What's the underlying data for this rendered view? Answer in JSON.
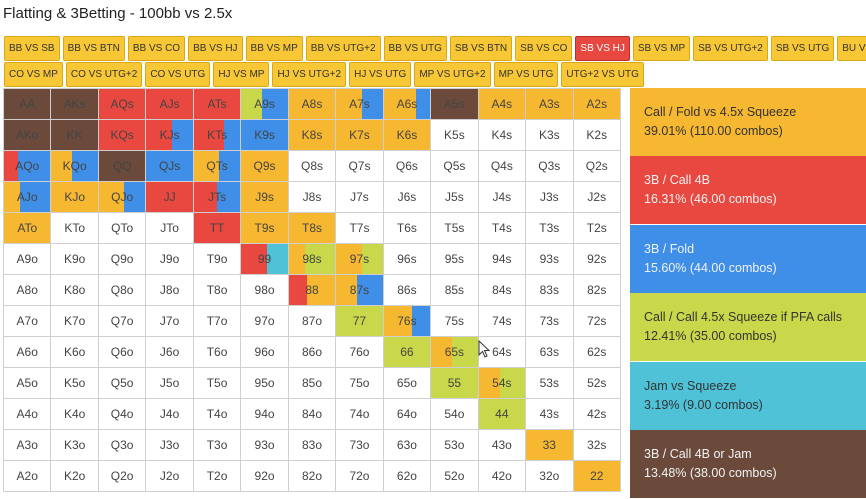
{
  "title": "Flatting & 3Betting - 100bb vs 2.5x",
  "colors": {
    "call": "#f6b731",
    "threebet_call": "#e84840",
    "threebet_fold": "#3f8fe8",
    "call_squeeze": "#c8d84a",
    "jam": "#4fc2d7",
    "threebet_jam": "#6b4a3c"
  },
  "tabs_row1": [
    "BB VS SB",
    "BB VS BTN",
    "BB VS CO",
    "BB VS HJ",
    "BB VS MP",
    "BB VS UTG+2",
    "BB VS UTG",
    "SB VS BTN",
    "SB VS CO",
    "SB VS HJ",
    "SB VS MP",
    "SB VS UTG+2",
    "SB VS UTG",
    "BU VS I"
  ],
  "tabs_row2": [
    "CO VS MP",
    "CO VS UTG+2",
    "CO VS UTG",
    "HJ VS MP",
    "HJ VS UTG+2",
    "HJ VS UTG",
    "MP VS UTG+2",
    "MP VS UTG",
    "UTG+2 VS UTG"
  ],
  "active_tab": "SB VS HJ",
  "legend": [
    {
      "key": "call",
      "name": "Call / Fold vs 4.5x Squeeze",
      "stat": "39.01% (110.00 combos)"
    },
    {
      "key": "threebet_call",
      "name": "3B / Call 4B",
      "stat": "16.31% (46.00 combos)"
    },
    {
      "key": "threebet_fold",
      "name": "3B / Fold",
      "stat": "15.60% (44.00 combos)"
    },
    {
      "key": "call_squeeze",
      "name": "Call / Call 4.5x Squeeze if PFA calls",
      "stat": "12.41% (35.00 combos)"
    },
    {
      "key": "jam",
      "name": "Jam vs Squeeze",
      "stat": "3.19% (9.00 combos)"
    },
    {
      "key": "threebet_jam",
      "name": "3B / Call 4B or Jam",
      "stat": "13.48% (38.00 combos)"
    }
  ],
  "hands": [
    [
      "AA",
      "AKs",
      "AQs",
      "AJs",
      "ATs",
      "A9s",
      "A8s",
      "A7s",
      "A6s",
      "A5s",
      "A4s",
      "A3s",
      "A2s"
    ],
    [
      "AKo",
      "KK",
      "KQs",
      "KJs",
      "KTs",
      "K9s",
      "K8s",
      "K7s",
      "K6s",
      "K5s",
      "K4s",
      "K3s",
      "K2s"
    ],
    [
      "AQo",
      "KQo",
      "QQ",
      "QJs",
      "QTs",
      "Q9s",
      "Q8s",
      "Q7s",
      "Q6s",
      "Q5s",
      "Q4s",
      "Q3s",
      "Q2s"
    ],
    [
      "AJo",
      "KJo",
      "QJo",
      "JJ",
      "JTs",
      "J9s",
      "J8s",
      "J7s",
      "J6s",
      "J5s",
      "J4s",
      "J3s",
      "J2s"
    ],
    [
      "ATo",
      "KTo",
      "QTo",
      "JTo",
      "TT",
      "T9s",
      "T8s",
      "T7s",
      "T6s",
      "T5s",
      "T4s",
      "T3s",
      "T2s"
    ],
    [
      "A9o",
      "K9o",
      "Q9o",
      "J9o",
      "T9o",
      "99",
      "98s",
      "97s",
      "96s",
      "95s",
      "94s",
      "93s",
      "92s"
    ],
    [
      "A8o",
      "K8o",
      "Q8o",
      "J8o",
      "T8o",
      "98o",
      "88",
      "87s",
      "86s",
      "85s",
      "84s",
      "83s",
      "82s"
    ],
    [
      "A7o",
      "K7o",
      "Q7o",
      "J7o",
      "T7o",
      "97o",
      "87o",
      "77",
      "76s",
      "75s",
      "74s",
      "73s",
      "72s"
    ],
    [
      "A6o",
      "K6o",
      "Q6o",
      "J6o",
      "T6o",
      "96o",
      "86o",
      "76o",
      "66",
      "65s",
      "64s",
      "63s",
      "62s"
    ],
    [
      "A5o",
      "K5o",
      "Q5o",
      "J5o",
      "T5o",
      "95o",
      "85o",
      "75o",
      "65o",
      "55",
      "54s",
      "53s",
      "52s"
    ],
    [
      "A4o",
      "K4o",
      "Q4o",
      "J4o",
      "T4o",
      "94o",
      "84o",
      "74o",
      "64o",
      "54o",
      "44",
      "43s",
      "42s"
    ],
    [
      "A3o",
      "K3o",
      "Q3o",
      "J3o",
      "T3o",
      "93o",
      "83o",
      "73o",
      "63o",
      "53o",
      "43o",
      "33",
      "32s"
    ],
    [
      "A2o",
      "K2o",
      "Q2o",
      "J2o",
      "T2o",
      "92o",
      "82o",
      "72o",
      "62o",
      "52o",
      "42o",
      "32o",
      "22"
    ]
  ],
  "strategy": {
    "AA": [
      [
        "threebet_jam",
        1.0
      ]
    ],
    "AKs": [
      [
        "threebet_jam",
        1.0
      ]
    ],
    "AQs": [
      [
        "threebet_call",
        1.0
      ]
    ],
    "AJs": [
      [
        "threebet_call",
        1.0
      ]
    ],
    "ATs": [
      [
        "threebet_call",
        1.0
      ]
    ],
    "A9s": [
      [
        "call_squeeze",
        0.45
      ],
      [
        "threebet_fold",
        0.55
      ]
    ],
    "A8s": [
      [
        "call",
        1.0
      ]
    ],
    "A7s": [
      [
        "call",
        0.55
      ],
      [
        "threebet_fold",
        0.45
      ]
    ],
    "A6s": [
      [
        "call",
        0.7
      ],
      [
        "threebet_fold",
        0.3
      ]
    ],
    "A5s": [
      [
        "threebet_jam",
        1.0
      ]
    ],
    "A4s": [
      [
        "call",
        1.0
      ]
    ],
    "A3s": [
      [
        "call",
        1.0
      ]
    ],
    "A2s": [
      [
        "call",
        1.0
      ]
    ],
    "AKo": [
      [
        "threebet_jam",
        1.0
      ]
    ],
    "KK": [
      [
        "threebet_jam",
        1.0
      ]
    ],
    "KQs": [
      [
        "threebet_call",
        1.0
      ]
    ],
    "KJs": [
      [
        "threebet_call",
        0.55
      ],
      [
        "threebet_fold",
        0.45
      ]
    ],
    "KTs": [
      [
        "threebet_call",
        0.65
      ],
      [
        "threebet_fold",
        0.35
      ]
    ],
    "K9s": [
      [
        "threebet_fold",
        1.0
      ]
    ],
    "K8s": [
      [
        "call",
        1.0
      ]
    ],
    "K7s": [
      [
        "call",
        1.0
      ]
    ],
    "K6s": [
      [
        "call",
        1.0
      ]
    ],
    "AQo": [
      [
        "threebet_call",
        0.3
      ],
      [
        "threebet_fold",
        0.7
      ]
    ],
    "KQo": [
      [
        "call",
        0.45
      ],
      [
        "threebet_fold",
        0.55
      ]
    ],
    "QQ": [
      [
        "threebet_jam",
        1.0
      ]
    ],
    "QJs": [
      [
        "threebet_fold",
        1.0
      ]
    ],
    "QTs": [
      [
        "call",
        0.55
      ],
      [
        "threebet_fold",
        0.45
      ]
    ],
    "Q9s": [
      [
        "call",
        1.0
      ]
    ],
    "AJo": [
      [
        "call",
        0.35
      ],
      [
        "threebet_fold",
        0.65
      ]
    ],
    "KJo": [
      [
        "call",
        1.0
      ]
    ],
    "QJo": [
      [
        "call",
        0.55
      ],
      [
        "threebet_fold",
        0.45
      ]
    ],
    "JJ": [
      [
        "threebet_call",
        1.0
      ]
    ],
    "JTs": [
      [
        "threebet_call",
        0.5
      ],
      [
        "threebet_fold",
        0.5
      ]
    ],
    "J9s": [
      [
        "call",
        1.0
      ]
    ],
    "ATo": [
      [
        "call",
        1.0
      ]
    ],
    "TT": [
      [
        "threebet_call",
        1.0
      ]
    ],
    "T9s": [
      [
        "call",
        1.0
      ]
    ],
    "T8s": [
      [
        "call",
        1.0
      ]
    ],
    "99": [
      [
        "threebet_call",
        0.55
      ],
      [
        "jam",
        0.45
      ]
    ],
    "98s": [
      [
        "call",
        0.35
      ],
      [
        "call_squeeze",
        0.65
      ]
    ],
    "97s": [
      [
        "call",
        0.55
      ],
      [
        "call_squeeze",
        0.45
      ]
    ],
    "88": [
      [
        "threebet_call",
        0.4
      ],
      [
        "call",
        0.6
      ]
    ],
    "87s": [
      [
        "call",
        0.45
      ],
      [
        "threebet_fold",
        0.55
      ]
    ],
    "77": [
      [
        "call_squeeze",
        1.0
      ]
    ],
    "76s": [
      [
        "call",
        0.6
      ],
      [
        "threebet_fold",
        0.4
      ]
    ],
    "66": [
      [
        "call_squeeze",
        1.0
      ]
    ],
    "65s": [
      [
        "call",
        0.45
      ],
      [
        "call_squeeze",
        0.55
      ]
    ],
    "55": [
      [
        "call_squeeze",
        1.0
      ]
    ],
    "54s": [
      [
        "call",
        0.45
      ],
      [
        "call_squeeze",
        0.55
      ]
    ],
    "44": [
      [
        "call_squeeze",
        1.0
      ]
    ],
    "33": [
      [
        "call",
        1.0
      ]
    ],
    "22": [
      [
        "call",
        1.0
      ]
    ]
  }
}
